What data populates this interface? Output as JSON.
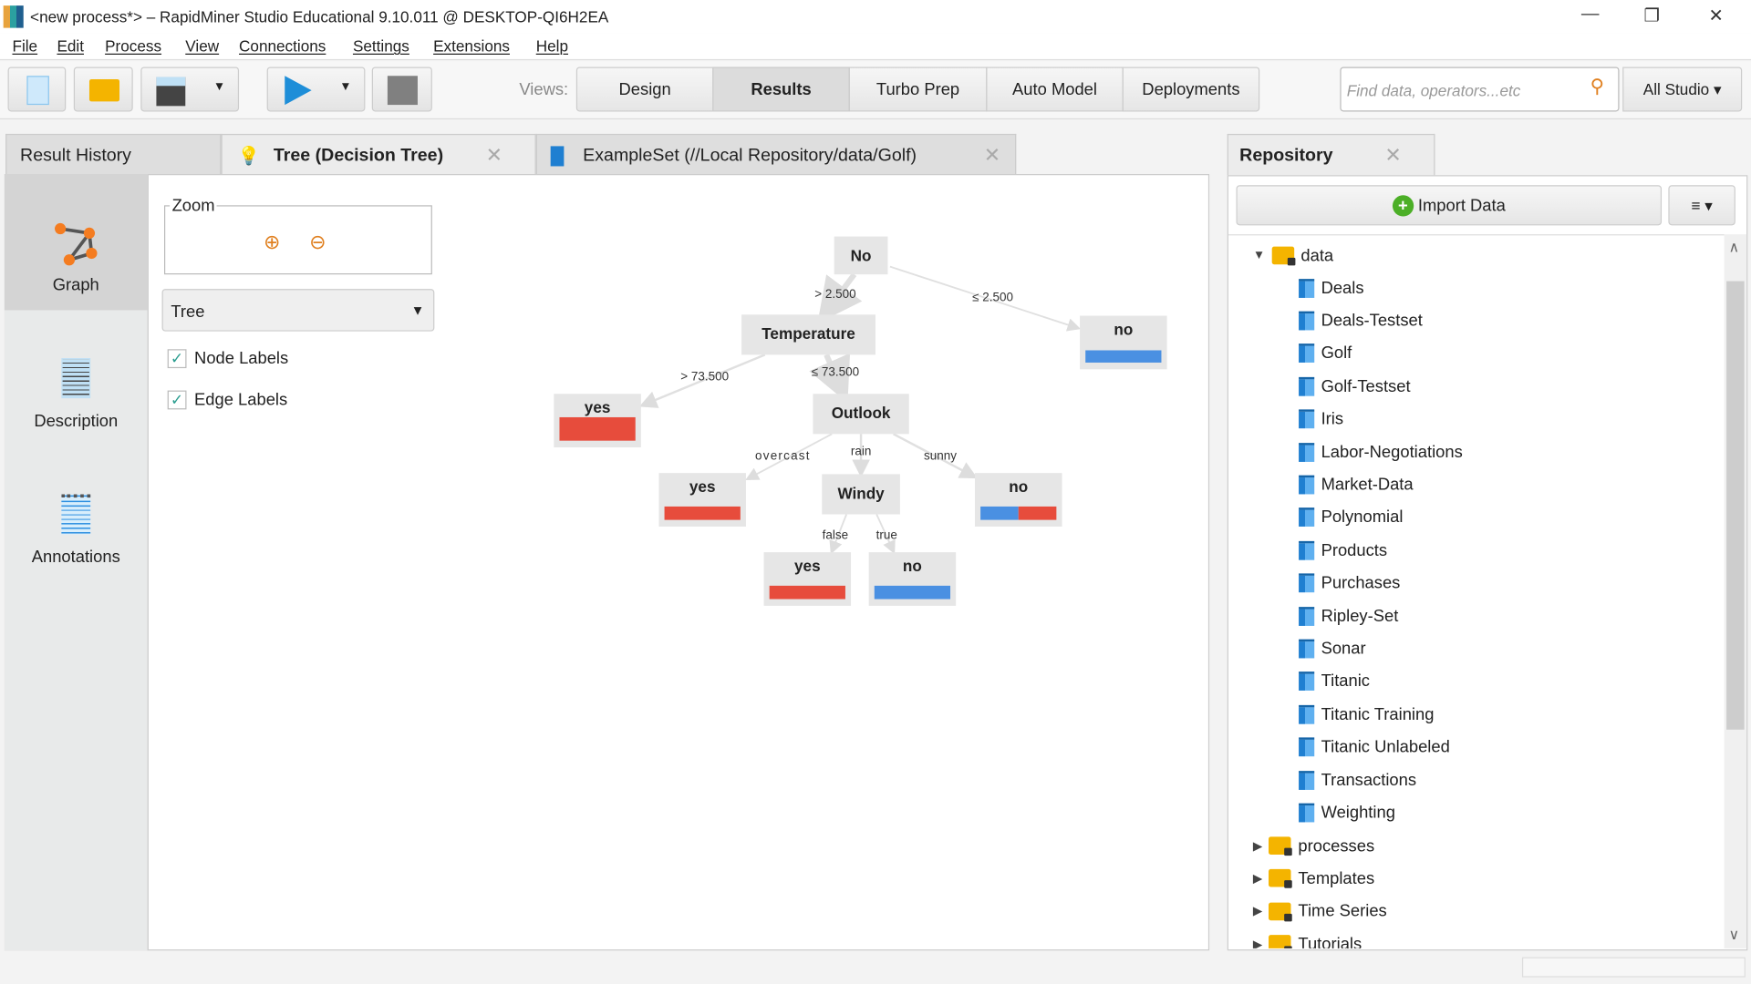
{
  "window": {
    "title": "<new process*> – RapidMiner Studio Educational 9.10.011 @ DESKTOP-QI6H2EA",
    "minimize": "—",
    "restore": "❐",
    "close": "✕"
  },
  "menu": [
    "File",
    "Edit",
    "Process",
    "View",
    "Connections",
    "Settings",
    "Extensions",
    "Help"
  ],
  "toolbar": {
    "views_label": "Views:",
    "views": [
      "Design",
      "Results",
      "Turbo Prep",
      "Auto Model",
      "Deployments"
    ],
    "active_view": "Results",
    "search_placeholder": "Find data, operators...etc",
    "scope": "All Studio ▾"
  },
  "tabs": [
    {
      "label": "Result History"
    },
    {
      "label": "Tree (Decision Tree)",
      "active": true
    },
    {
      "label": "ExampleSet (//Local Repository/data/Golf)"
    }
  ],
  "close_glyph": "✕",
  "side": {
    "items": [
      "Graph",
      "Description",
      "Annotations"
    ],
    "active": "Graph"
  },
  "options": {
    "zoom_label": "Zoom",
    "layout": "Tree",
    "node_labels": {
      "label": "Node Labels",
      "checked": true
    },
    "edge_labels": {
      "label": "Edge Labels",
      "checked": true
    },
    "check": "✓"
  },
  "colors": {
    "yes": "#e74c3c",
    "no": "#4a90e2",
    "node_bg": "#e6e6e6"
  },
  "tree": {
    "nodes": {
      "root": "No",
      "temperature": "Temperature",
      "outlook": "Outlook",
      "windy": "Windy"
    },
    "leaves": {
      "root_le": {
        "label": "no",
        "dist": {
          "no": 1,
          "yes": 0
        }
      },
      "temp_gt": {
        "label": "yes",
        "dist": {
          "no": 0,
          "yes": 1
        }
      },
      "overcast": {
        "label": "yes",
        "dist": {
          "no": 0,
          "yes": 1
        }
      },
      "sunny": {
        "label": "no",
        "dist": {
          "no": 0.5,
          "yes": 0.5
        }
      },
      "windy_false": {
        "label": "yes",
        "dist": {
          "no": 0,
          "yes": 1
        }
      },
      "windy_true": {
        "label": "no",
        "dist": {
          "no": 1,
          "yes": 0
        }
      }
    },
    "edges": {
      "root_gt": "> 2.500",
      "root_le": "≤ 2.500",
      "temp_gt": "> 73.500",
      "temp_le": "≤ 73.500",
      "overcast": "overcast",
      "rain": "rain",
      "sunny": "sunny",
      "false": "false",
      "true": "true"
    }
  },
  "repository": {
    "title": "Repository",
    "import": "Import Data",
    "menu": "≡ ▾",
    "root": "data",
    "items": [
      "Deals",
      "Deals-Testset",
      "Golf",
      "Golf-Testset",
      "Iris",
      "Labor-Negotiations",
      "Market-Data",
      "Polynomial",
      "Products",
      "Purchases",
      "Ripley-Set",
      "Sonar",
      "Titanic",
      "Titanic Training",
      "Titanic Unlabeled",
      "Transactions",
      "Weighting"
    ],
    "folders": [
      "processes",
      "Templates",
      "Time Series",
      "Tutorials"
    ]
  }
}
